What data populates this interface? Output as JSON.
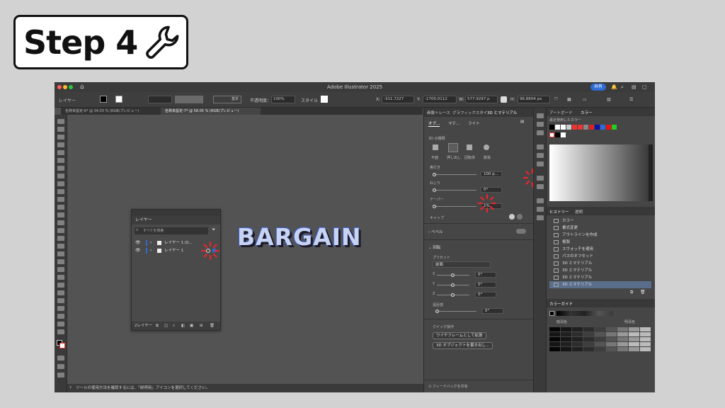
{
  "badge": {
    "text": "Step 4",
    "icon": "wrench-icon"
  },
  "window": {
    "title": "Adobe Illustrator 2025",
    "control_bar": {
      "layer_label": "レイヤー",
      "stroke_style": "基本",
      "opacity_label": "不透明度：",
      "opacity_value": "100%",
      "style_label": "スタイル",
      "x_label": "X:",
      "x_value": "-311.7227",
      "y_label": "Y:",
      "y_value": "-1700.0112",
      "w_label": "W:",
      "w_value": "577.9297 p",
      "h_label": "H:",
      "h_value": "96.8604 px",
      "share_button": "共有"
    },
    "doc_tabs": [
      "名称未設定-6* @ 34.03 % (RGB/プレビュー)",
      "名称未設定-7* @ 58.05 % (RGB/プレビュー)"
    ]
  },
  "layers_panel": {
    "tab": "レイヤー",
    "search_placeholder": "すべてを検索",
    "rows": [
      "レイヤー 1 (0...",
      "レイヤー 1"
    ],
    "footer": "2レイヤー"
  },
  "artwork_text": "BARGAIN",
  "status_text": "ツールの使用方法を確認するには、「説明用」アイコンを選択してください。",
  "panel_3d": {
    "tabs": [
      "画像トレース",
      "グラフィックスタイ",
      "3D とマテリアル"
    ],
    "subtabs": [
      "オブ...",
      "マテ...",
      "ライト"
    ],
    "type_label": "3D の種類",
    "types": [
      "平面",
      "押し出し",
      "回転体",
      "膨張"
    ],
    "depth_label": "奥行き",
    "depth_value": "100 p...",
    "twist_label": "ねじり",
    "twist_value": "0°",
    "taper_label": "テーパー",
    "taper_value": "1%",
    "cap_label": "キャップ",
    "bevel_label": "ベベル",
    "rotation_label": "回転",
    "preset_label": "プリセット",
    "preset_value": "前面",
    "x_label": "X",
    "x_value": "0°",
    "y_label": "Y",
    "y_value": "0°",
    "z_label": "Z",
    "z_value": "0°",
    "perspective_label": "遠近感",
    "perspective_value": "0°",
    "quick_label": "クイック操作",
    "wireframe_button": "ワイヤフレームとして拡張",
    "export_button": "3D オブジェクトを書き出し...",
    "feedback": "フィードバックを共有"
  },
  "right_panel": {
    "top_tabs": [
      "アートボード",
      "カラー"
    ],
    "recent_label": "最近使用したカラー",
    "history_tabs": [
      "ヒストリー",
      "透明"
    ],
    "history_items": [
      "カラー",
      "書式変更",
      "アウトラインを作成",
      "複製",
      "スウォッチを適用",
      "パスのオフセット",
      "3D とマテリアル",
      "3D とマテリアル",
      "3D とマテリアル",
      "3D とマテリアル"
    ],
    "guide_tab": "カラーガイド",
    "dark_label": "暗清色",
    "light_label": "明清色"
  },
  "colors": {
    "accent": "#2d6bd6",
    "highlight": "#e8262c",
    "canvas": "#535353"
  }
}
